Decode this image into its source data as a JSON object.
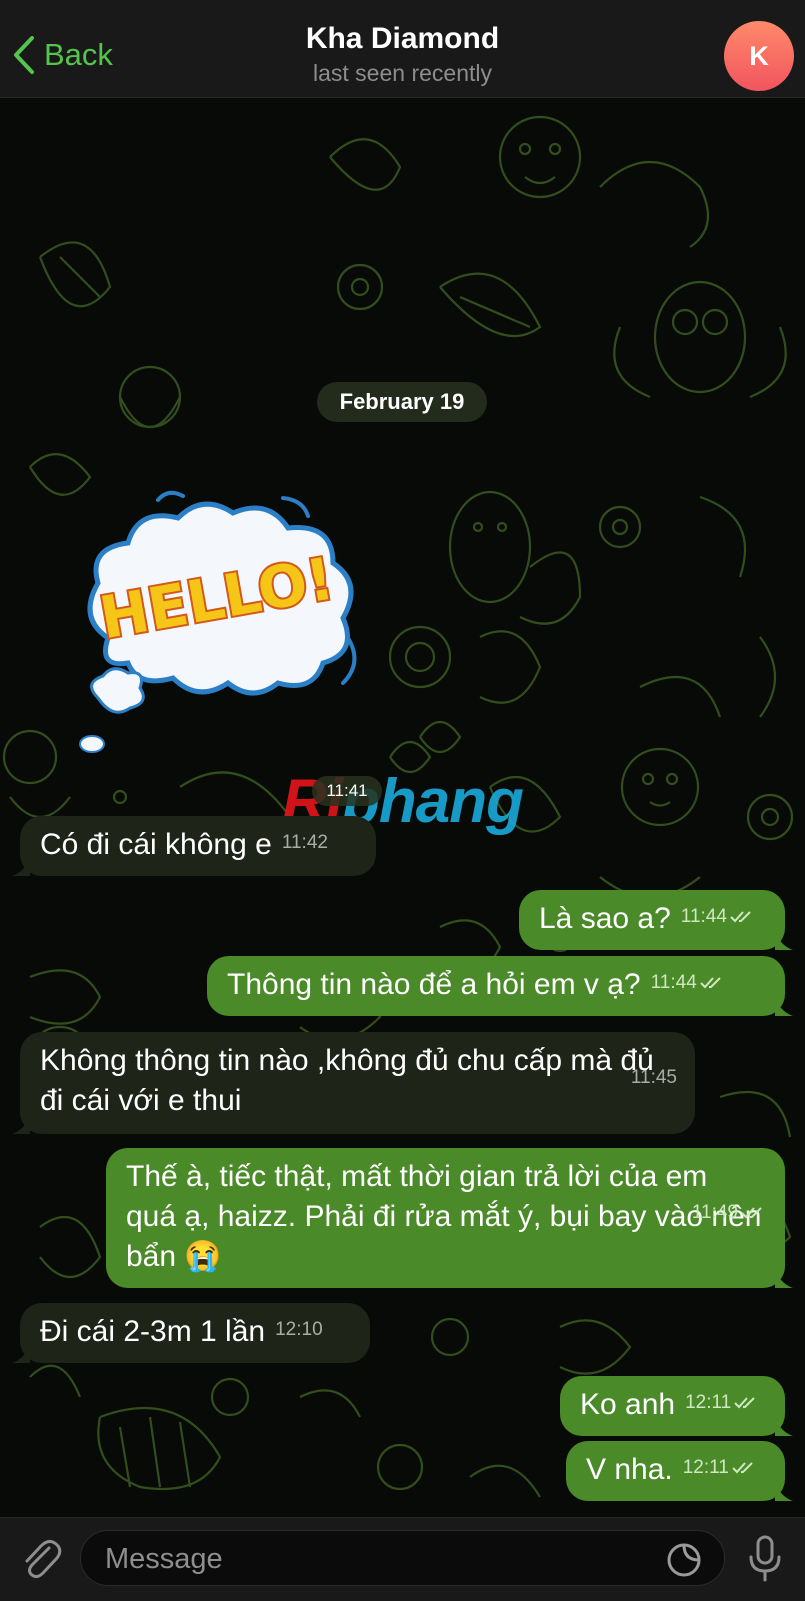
{
  "header": {
    "back_label": "Back",
    "title": "Kha Diamond",
    "subtitle": "last seen recently",
    "avatar_letter": "K"
  },
  "date_separator": "February 19",
  "sticker": {
    "text": "HELLO!",
    "time": "11:41"
  },
  "watermark": {
    "part1": "Ri",
    "part2": "phang"
  },
  "messages": [
    {
      "dir": "in",
      "text": "Có đi cái không e",
      "time": "11:42"
    },
    {
      "dir": "out",
      "text": "Là sao a?",
      "time": "11:44",
      "status": "read"
    },
    {
      "dir": "out",
      "text": "Thông tin nào để a hỏi em v ạ?",
      "time": "11:44",
      "status": "read"
    },
    {
      "dir": "in",
      "text": "Không thông tin nào ,không đủ chu cấp mà đủ đi cái với e thui",
      "time": "11:45"
    },
    {
      "dir": "out",
      "text": "Thế à, tiếc thật, mất thời gian trả lời của em quá ạ, haizz. Phải đi rửa mắt ý, bụi bay vào nên bẩn 😭",
      "time": "11:49",
      "status": "read"
    },
    {
      "dir": "in",
      "text": "Đi cái 2-3m 1 lần",
      "time": "12:10"
    },
    {
      "dir": "out",
      "text": "Ko anh",
      "time": "12:11",
      "status": "read"
    },
    {
      "dir": "out",
      "text": "V nha.",
      "time": "12:11",
      "status": "read"
    }
  ],
  "input": {
    "placeholder": "Message"
  },
  "icons": {
    "back": "chevron-left-icon",
    "attach": "paperclip-icon",
    "sticker": "sticker-icon",
    "mic": "microphone-icon",
    "read_status": "double-check-icon"
  },
  "colors": {
    "accent": "#54c44a",
    "outgoing_bubble": "#4b8a29",
    "incoming_bubble": "#1e2418",
    "background": "#070a06"
  }
}
